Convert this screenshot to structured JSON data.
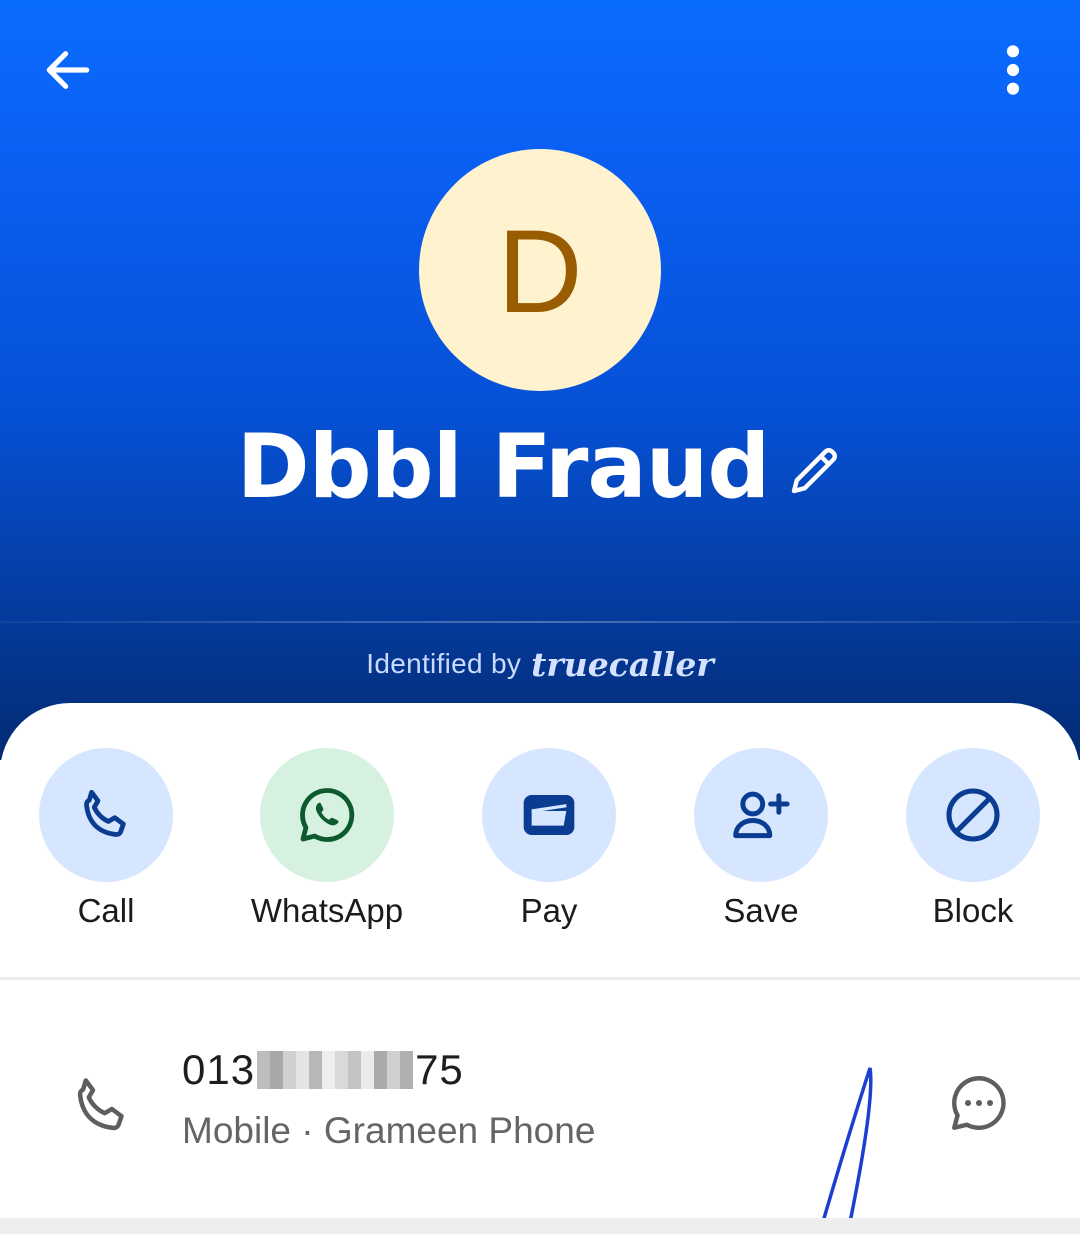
{
  "header": {
    "back_icon": "arrow-left-icon",
    "more_icon": "more-vertical-icon",
    "avatar_letter": "D",
    "contact_name": "Dbbl Fraud",
    "edit_icon": "pencil-icon",
    "identified_label": "Identified by",
    "brand_name": "truecaller"
  },
  "actions": [
    {
      "label": "Call",
      "icon": "phone-icon"
    },
    {
      "label": "WhatsApp",
      "icon": "whatsapp-icon"
    },
    {
      "label": "Pay",
      "icon": "wallet-icon"
    },
    {
      "label": "Save",
      "icon": "add-person-icon"
    },
    {
      "label": "Block",
      "icon": "block-icon"
    }
  ],
  "phone": {
    "number_prefix": "013",
    "number_suffix": "75",
    "type": "Mobile",
    "separator": "·",
    "carrier": "Grameen Phone",
    "icon": "phone-icon",
    "message_icon": "message-bubble-icon"
  },
  "colors": {
    "header_top": "#0a6cff",
    "header_bottom": "#032a72",
    "avatar_bg": "#fff2cf",
    "avatar_letter": "#9a5c00",
    "action_circle": "#d6e6ff",
    "whatsapp_circle": "#d6f1e0",
    "icon_blue": "#0a3d91",
    "whatsapp_green": "#0c5a2e"
  }
}
